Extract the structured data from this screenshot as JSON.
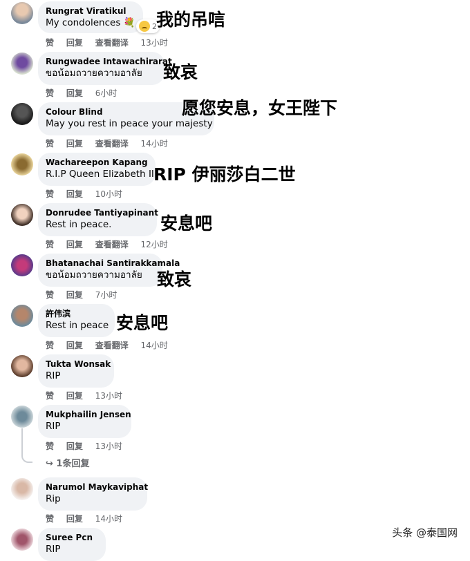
{
  "comments": [
    {
      "name": "Rungrat Viratikul",
      "text": "My condolences 💐",
      "reaction_count": "2",
      "actions": [
        "赞",
        "回复",
        "查看翻译"
      ],
      "time": "13小时",
      "annotation": "我的吊唁"
    },
    {
      "name": "Rungwadee Intawachirarat",
      "text": "ขอน้อมถวายความอาลัย",
      "actions": [
        "赞",
        "回复"
      ],
      "time": "6小时",
      "annotation": "致哀"
    },
    {
      "name": "Colour Blind",
      "text": "May you rest in peace your majesty",
      "actions": [
        "赞",
        "回复",
        "查看翻译"
      ],
      "time": "14小时",
      "annotation": "愿您安息，女王陛下"
    },
    {
      "name": "Wachareepon Kapang",
      "text": "R.I.P Queen Elizabeth II",
      "actions": [
        "赞",
        "回复"
      ],
      "time": "10小时",
      "annotation": "RIP 伊丽莎白二世"
    },
    {
      "name": "Donrudee Tantiyapinant",
      "text": "Rest in peace.",
      "actions": [
        "赞",
        "回复",
        "查看翻译"
      ],
      "time": "12小时",
      "annotation": "安息吧"
    },
    {
      "name": "Bhatanachai Santirakkamala",
      "text": "ขอน้อมถวายความอาลัย",
      "actions": [
        "赞",
        "回复"
      ],
      "time": "7小时",
      "annotation": "致哀"
    },
    {
      "name": "許伟滨",
      "text": "Rest in peace",
      "actions": [
        "赞",
        "回复",
        "查看翻译"
      ],
      "time": "14小时",
      "annotation": "安息吧"
    },
    {
      "name": "Tukta Wonsak",
      "text": "RIP",
      "actions": [
        "赞",
        "回复"
      ],
      "time": "13小时",
      "annotation": ""
    },
    {
      "name": "Mukphailin Jensen",
      "text": "RIP",
      "actions": [
        "赞",
        "回复"
      ],
      "time": "13小时",
      "annotation": ""
    },
    {
      "name": "Narumol Maykaviphat",
      "text": "Rip",
      "actions": [
        "赞",
        "回复"
      ],
      "time": "14小时",
      "annotation": ""
    },
    {
      "name": "Suree Pcn",
      "text": "RIP",
      "actions": [],
      "time": "",
      "annotation": ""
    }
  ],
  "replies_link": "↪ 1条回复",
  "watermark": "头条 @泰国网",
  "colors": {
    "bubble": "#f0f2f5",
    "meta": "#65676b",
    "text": "#050505"
  }
}
